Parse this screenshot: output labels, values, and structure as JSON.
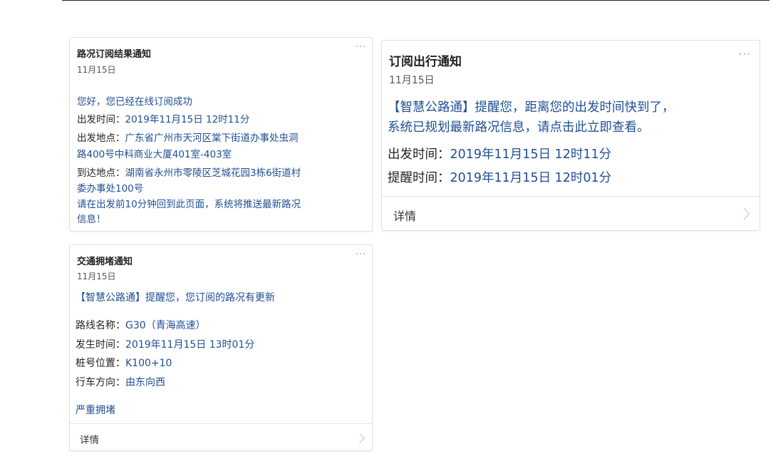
{
  "cards": [
    {
      "title": "路况订阅结果通知",
      "date": "11月15日",
      "more": "···",
      "greeting": "您好，您已经在线订阅成功",
      "depart_time_label": "出发时间：",
      "depart_time": "2019年11月15日 12时11分",
      "depart_place_label": "出发地点：",
      "depart_place_1": "广东省广州市天河区棠下街道办事处虫洞",
      "depart_place_2": "路400号中科商业大厦401室-403室",
      "arrive_place_label": "到达地点：",
      "arrive_place_1": "湖南省永州市零陵区芝城花园3栋6街道村",
      "arrive_place_2": "委办事处100号",
      "notice_1": "请在出发前10分钟回到此页面，系统将推送最新路况",
      "notice_2": "信息！"
    },
    {
      "title": "订阅出行通知",
      "date": "11月15日",
      "more": "···",
      "message_1": "【智慧公路通】提醒您，距离您的出发时间快到了，",
      "message_2": "系统已规划最新路况信息，请点击此立即查看。",
      "depart_time_label": "出发时间：",
      "depart_time": "2019年11月15日 12时11分",
      "remind_time_label": "提醒时间：",
      "remind_time": "2019年11月15日 12时01分",
      "detail_label": "详情"
    },
    {
      "title": "交通拥堵通知",
      "date": "11月15日",
      "more": "···",
      "message": "【智慧公路通】提醒您，您订阅的路况有更新",
      "route_label": "路线名称：",
      "route": "G30（青海高速）",
      "occur_label": "发生时间：",
      "occur": "2019年11月15日 13时01分",
      "stake_label": "桩号位置：",
      "stake": "K100+10",
      "direction_label": "行车方向：",
      "direction": "由东向西",
      "status": "严重拥堵",
      "detail_label": "详情"
    }
  ]
}
